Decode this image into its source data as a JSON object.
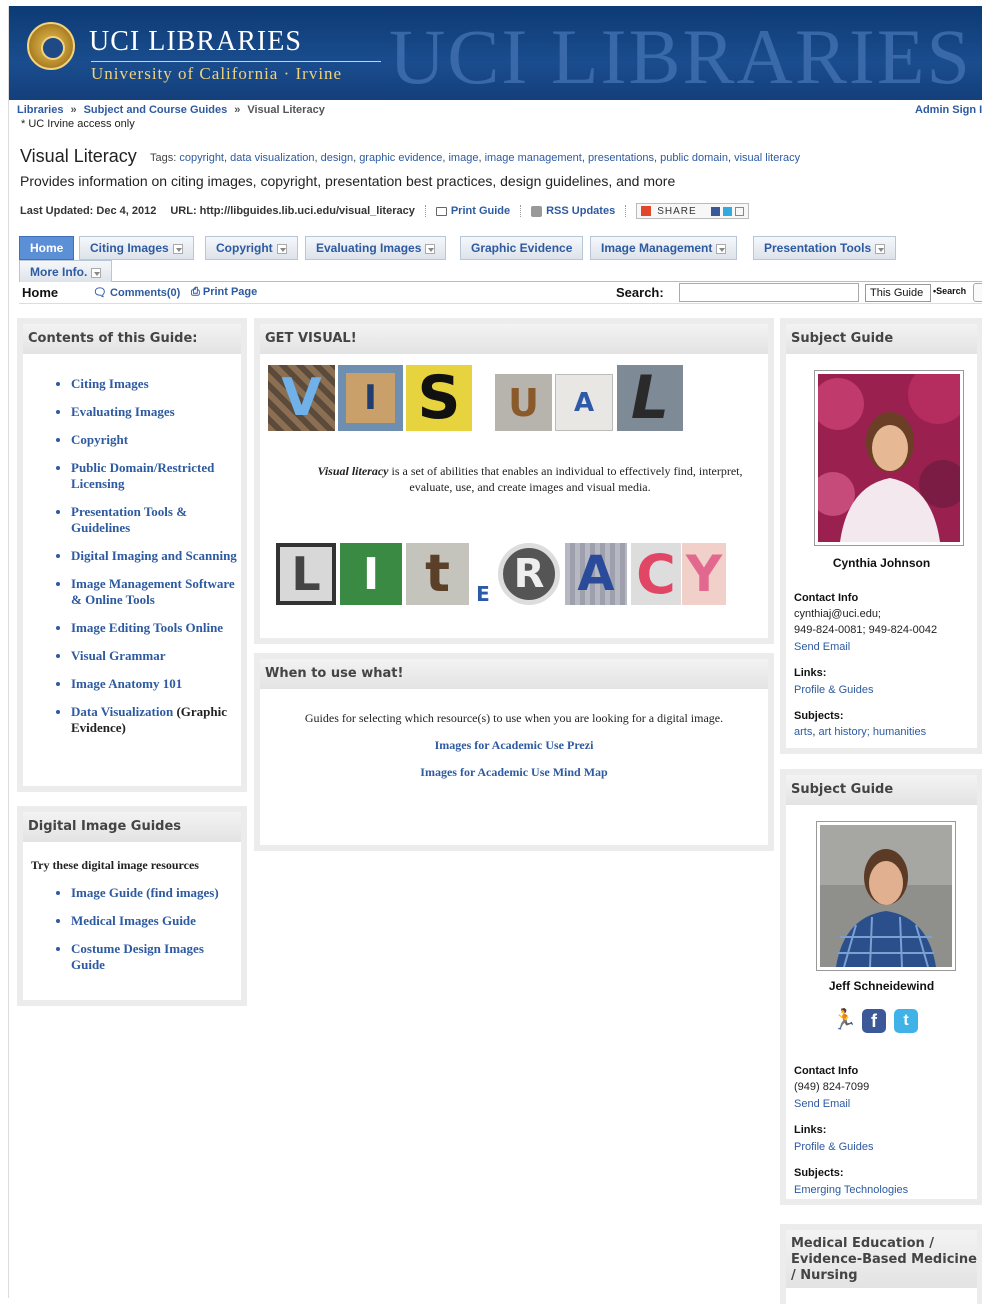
{
  "banner": {
    "title": "UCI LIBRARIES",
    "subtitle": "University of California · Irvine",
    "watermark": "UCI LIBRARIES"
  },
  "breadcrumb": {
    "items": [
      "Libraries",
      "Subject and Course Guides",
      "Visual Literacy"
    ],
    "separator": "»"
  },
  "access_note": "* UC Irvine access only",
  "admin_link": "Admin Sign In",
  "guide": {
    "title": "Visual Literacy",
    "tags_label": "Tags:",
    "tags": [
      "copyright",
      "data visualization",
      "design",
      "graphic evidence",
      "image",
      "image management",
      "presentations",
      "public domain",
      "visual literacy"
    ],
    "description": "Provides information on citing images, copyright, presentation best practices, design guidelines, and more",
    "last_updated": "Last Updated: Dec 4, 2012",
    "url": "URL: http://libguides.lib.uci.edu/visual_literacy",
    "print_guide": "Print Guide",
    "rss": "RSS Updates",
    "share": "SHARE"
  },
  "tabs": [
    {
      "label": "Home",
      "active": true,
      "dropdown": false
    },
    {
      "label": "Citing Images",
      "dropdown": true
    },
    {
      "label": "Copyright",
      "dropdown": true
    },
    {
      "label": "Evaluating Images",
      "dropdown": true
    },
    {
      "label": "Graphic Evidence",
      "dropdown": false
    },
    {
      "label": "Image Management",
      "dropdown": true
    },
    {
      "label": "Presentation Tools",
      "dropdown": true
    },
    {
      "label": "More Info.",
      "dropdown": true
    }
  ],
  "subnav": {
    "home": "Home",
    "comments": "Comments(0)",
    "print_page": "Print Page",
    "search_label": "Search:",
    "search_scope": "This Guide",
    "search_button": "•Search"
  },
  "contents_box": {
    "title": "Contents of this Guide:",
    "items": [
      {
        "text": "Citing Images"
      },
      {
        "text": "Evaluating Images"
      },
      {
        "text": "Copyright"
      },
      {
        "text": "Public Domain/Restricted Licensing"
      },
      {
        "text": "Presentation Tools & Guidelines"
      },
      {
        "text": "Digital Imaging and Scanning"
      },
      {
        "text": "Image Management Software & Online Tools"
      },
      {
        "text": "Image Editing Tools Online"
      },
      {
        "text": "Visual Grammar"
      },
      {
        "text": "Image Anatomy 101"
      },
      {
        "text": "Data Visualization",
        "suffix": " (Graphic Evidence)"
      }
    ]
  },
  "digital_box": {
    "title": "Digital Image Guides",
    "intro": "Try these digital  image resources",
    "items": [
      "Image Guide (find images)",
      "Medical Images Guide",
      "Costume Design Images Guide"
    ]
  },
  "visual_box": {
    "title": "GET VISUAL!",
    "top_letters": [
      "V",
      "I",
      "S",
      "U",
      "A",
      "L"
    ],
    "bottom_letters": [
      "L",
      "I",
      "t",
      "E",
      "R",
      "A",
      "C",
      "Y"
    ],
    "definition_term": "Visual literacy",
    "definition_rest": " is a set of abilities that enables an individual to effectively find, interpret, evaluate, use, and create images and visual media."
  },
  "when_box": {
    "title": "When to use what!",
    "intro": "Guides for selecting which resource(s) to use when you are looking for a digital image.",
    "link1": "Images for Academic Use Prezi",
    "link2": "Images for Academic Use Mind Map"
  },
  "subject1": {
    "title": "Subject Guide",
    "name": "Cynthia Johnson",
    "contact_label": "Contact Info",
    "email": "cynthiaj@uci.edu;",
    "phone": "949-824-0081; 949-824-0042",
    "send_email": "Send Email",
    "links_label": "Links:",
    "profile": "Profile & Guides",
    "subjects_label": "Subjects:",
    "subjects": [
      "arts",
      "art history; humanities"
    ]
  },
  "subject2": {
    "title": "Subject Guide",
    "name": "Jeff Schneidewind",
    "contact_label": "Contact Info",
    "phone": "(949) 824-7099",
    "send_email": "Send Email",
    "links_label": "Links:",
    "profile": "Profile & Guides",
    "subjects_label": "Subjects:",
    "subjects": [
      "Emerging Technologies"
    ]
  },
  "subject3": {
    "title": "Medical Education / Evidence-Based Medicine / Nursing"
  },
  "colors": {
    "banner": "#1a4d8e",
    "link": "#2d5aa0",
    "active_tab": "#5b8fd6"
  }
}
